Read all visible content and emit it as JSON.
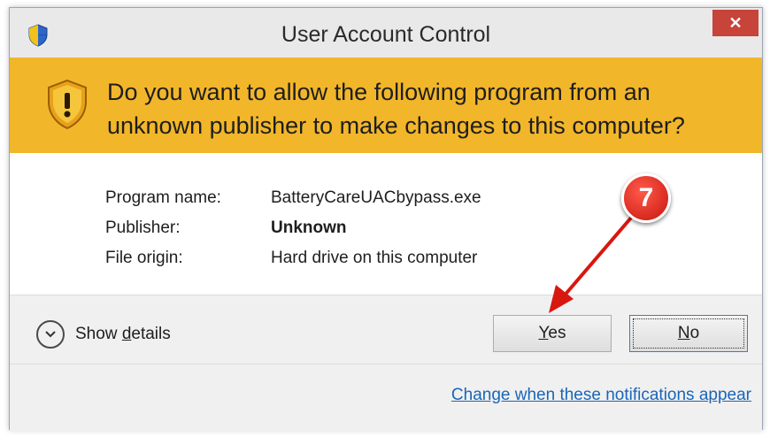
{
  "window": {
    "title": "User Account Control",
    "close_glyph": "✕"
  },
  "banner": {
    "prompt": "Do you want to allow the following program from an unknown publisher to make changes to this computer?",
    "icon": "uac-warning-shield-icon"
  },
  "info": {
    "rows": [
      {
        "label": "Program name:",
        "value": "BatteryCareUACbypass.exe"
      },
      {
        "label": "Publisher:",
        "value": "Unknown"
      },
      {
        "label": "File origin:",
        "value": "Hard drive on this computer"
      }
    ]
  },
  "actions": {
    "details_label_pre": "Show ",
    "details_label_mnemonic": "d",
    "details_label_post": "etails",
    "yes_mnemonic": "Y",
    "yes_rest": "es",
    "no_mnemonic": "N",
    "no_rest": "o"
  },
  "footer": {
    "link": "Change when these notifications appear"
  },
  "annotation": {
    "step_number": "7"
  },
  "colors": {
    "banner": "#f2b62a",
    "close": "#c7443a",
    "link": "#1a66b8",
    "callout": "#d8170f"
  }
}
